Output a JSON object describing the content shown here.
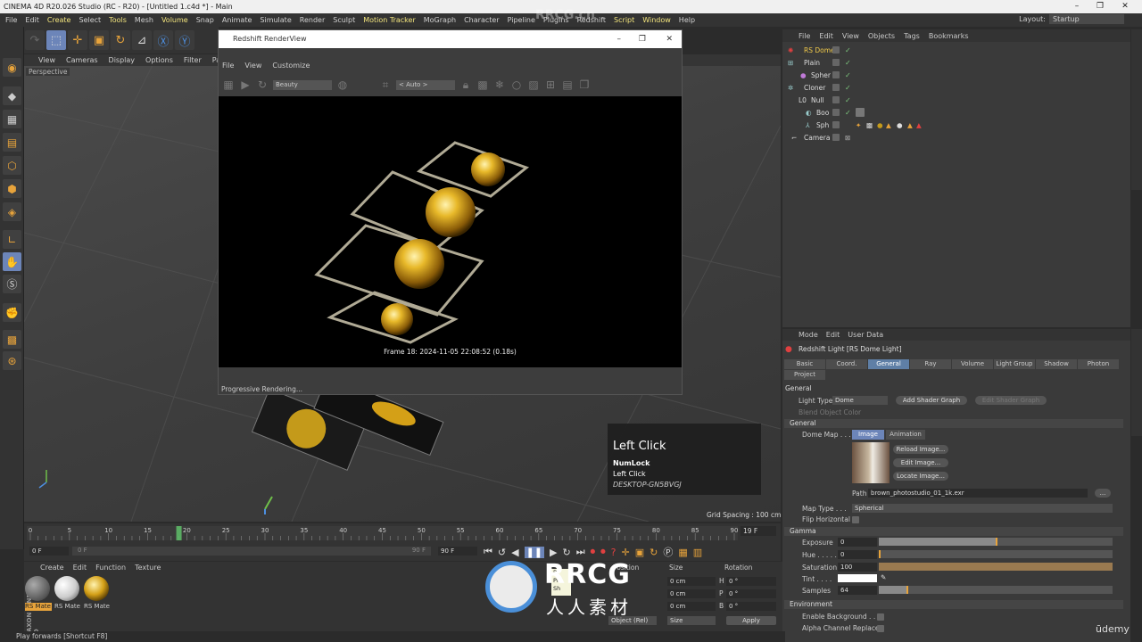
{
  "window": {
    "title": "CINEMA 4D R20.026 Studio (RC - R20) - [Untitled 1.c4d *] - Main",
    "minimize": "–",
    "restore": "❐",
    "close": "✕"
  },
  "menubar": {
    "items": [
      "File",
      "Edit",
      "Create",
      "Select",
      "Tools",
      "Mesh",
      "Volume",
      "Snap",
      "Animate",
      "Simulate",
      "Render",
      "Sculpt",
      "Motion Tracker",
      "MoGraph",
      "Character",
      "Pipeline",
      "Plugins",
      "Redshift",
      "Script",
      "Window",
      "Help"
    ],
    "layout_label": "Layout:",
    "layout_value": "Startup"
  },
  "viewport": {
    "menu": [
      "View",
      "Cameras",
      "Display",
      "Options",
      "Filter",
      "Panel",
      "Pr"
    ],
    "label": "Perspective",
    "grid_spacing": "Grid Spacing : 100 cm"
  },
  "renderview": {
    "title": "Redshift RenderView",
    "menu": [
      "File",
      "View",
      "Customize"
    ],
    "aov_select": "Beauty",
    "camera_select": "< Auto >",
    "frame_info": "Frame  18:  2024-11-05  22:08:52  (0.18s)",
    "status": "Progressive Rendering..."
  },
  "object_manager": {
    "menu": [
      "File",
      "Edit",
      "View",
      "Objects",
      "Tags",
      "Bookmarks"
    ],
    "objects": [
      {
        "name": "RS Dome",
        "color": "#f0c94a",
        "icon": "dome-light-icon"
      },
      {
        "name": "Plain",
        "color": "#d0d0d0",
        "icon": "plain-effector-icon"
      },
      {
        "name": "Spher",
        "color": "#d0d0d0",
        "icon": "sphere-icon"
      },
      {
        "name": "Cloner",
        "color": "#d0d0d0",
        "icon": "cloner-icon"
      },
      {
        "name": "Null",
        "color": "#d0d0d0",
        "icon": "null-icon"
      },
      {
        "name": "Boo",
        "color": "#d0d0d0",
        "icon": "boole-icon"
      },
      {
        "name": "Sph",
        "color": "#d0d0d0",
        "icon": "sphere-icon"
      },
      {
        "name": "Camera",
        "color": "#d0d0d0",
        "icon": "camera-icon"
      }
    ]
  },
  "attributes": {
    "menu": [
      "Mode",
      "Edit",
      "User Data"
    ],
    "title": "Redshift Light [RS Dome Light]",
    "tabs": [
      "Basic",
      "Coord.",
      "General",
      "Ray",
      "Volume",
      "Light Group",
      "Shadow",
      "Photon",
      "Project"
    ],
    "active_tab": "General",
    "section_general": "General",
    "light_type_label": "Light Type",
    "light_type_value": "Dome",
    "add_shader_graph": "Add Shader Graph",
    "edit_shader_graph": "Edit Shader Graph",
    "blend_label": "Blend Object Color",
    "subsection_general": "General",
    "dome_map_label": "Dome Map . . .",
    "image_tab": "Image",
    "animation_tab": "Animation",
    "reload_image": "Reload Image...",
    "edit_image": "Edit Image...",
    "locate_image": "Locate Image...",
    "path_label": "Path",
    "path_value": "brown_photostudio_01_1k.exr",
    "path_btn": "...",
    "map_type_label": "Map Type . . .",
    "map_type_value": "Spherical",
    "flip_label": "Flip Horizontal",
    "gamma_label": "Gamma",
    "exposure_label": "Exposure",
    "exposure_value": "0",
    "hue_label": "Hue . . . . .",
    "hue_value": "0",
    "saturation_label": "Saturation",
    "saturation_value": "100",
    "tint_label": "Tint . . . .",
    "samples_label": "Samples",
    "samples_value": "64",
    "environment_label": "Environment",
    "enable_bg_label": "Enable Background . . .",
    "alpha_label": "Alpha Channel Replace"
  },
  "timeline": {
    "ticks": [
      "0",
      "5",
      "10",
      "15",
      "20",
      "25",
      "30",
      "35",
      "40",
      "45",
      "50",
      "55",
      "60",
      "65",
      "70",
      "75",
      "80",
      "85",
      "90"
    ],
    "current_frame_display": "19 F",
    "start_frame": "0 F",
    "end_frame": "90 F",
    "range_start": "0 F",
    "range_end": "90 F",
    "current_frame": 19,
    "max_frame": 90
  },
  "materials": {
    "menu": [
      "Create",
      "Edit",
      "Function",
      "Texture"
    ],
    "items": [
      {
        "label": "RS Mate",
        "kind": "gray"
      },
      {
        "label": "RS Mate",
        "kind": "white"
      },
      {
        "label": "RS Mate",
        "kind": "gold"
      }
    ],
    "brand": "MAXON CINEMA 4D"
  },
  "coords": {
    "headers": [
      "Position",
      "Size",
      "Rotation"
    ],
    "rows": [
      {
        "s": "0 cm",
        "rl": "H",
        "r": "0 °"
      },
      {
        "s": "0 cm",
        "rl": "P",
        "r": "0 °"
      },
      {
        "s": "0 cm",
        "rl": "B",
        "r": "0 °"
      }
    ],
    "mode": "Object (Rel)",
    "size_mode": "Size",
    "apply": "Apply"
  },
  "overlay": {
    "title": "Left Click",
    "line1": "NumLock",
    "line2": "Left Click",
    "line3": "DESKTOP-GN5BVGJ"
  },
  "tooltip": [
    "Pl",
    "Pl",
    "Sh"
  ],
  "statusbar": "Play forwards [Shortcut F8]",
  "watermark": {
    "top": "RRCG.cn",
    "logo_en": "RRCG",
    "logo_cn": "人人素材",
    "udemy": "ūdemy"
  },
  "colors": {
    "accent_orange": "#e7a33b",
    "accent_blue": "#5f7fa6",
    "gold": "#d4a017"
  }
}
